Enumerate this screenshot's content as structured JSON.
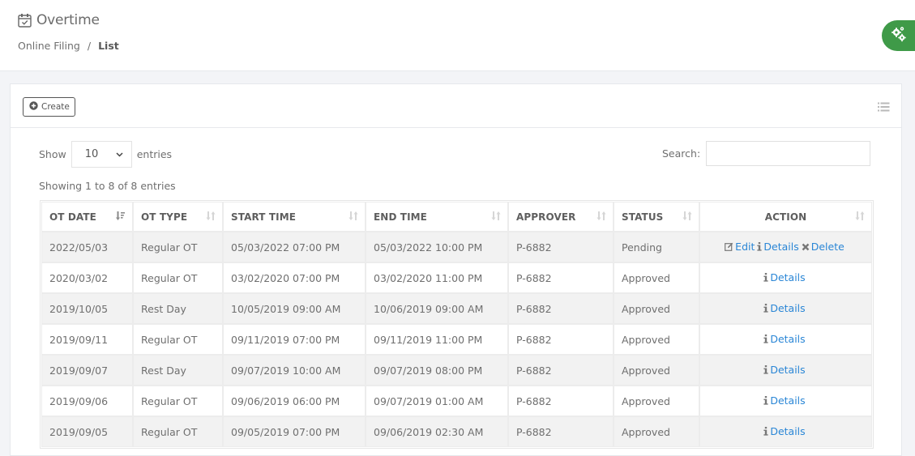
{
  "header": {
    "title": "Overtime",
    "title_icon": "calendar-check-icon",
    "breadcrumb": [
      {
        "label": "Online Filing",
        "active": false
      },
      {
        "label": "List",
        "active": true
      }
    ],
    "breadcrumb_separator": "/"
  },
  "fab": {
    "icon": "gears-icon",
    "color": "#3f9a48"
  },
  "toolbar": {
    "create_label": "Create",
    "create_icon": "plus-circle-icon",
    "list_toggle_icon": "list-icon"
  },
  "datatable": {
    "show_label": "Show",
    "entries_label": "entries",
    "page_length": "10",
    "search_label": "Search:",
    "search_value": "",
    "info": "Showing 1 to 8 of 8 entries",
    "columns": [
      {
        "label": "OT DATE",
        "sort": "desc"
      },
      {
        "label": "OT TYPE",
        "sort": "none"
      },
      {
        "label": "START TIME",
        "sort": "none"
      },
      {
        "label": "END TIME",
        "sort": "none"
      },
      {
        "label": "APPROVER",
        "sort": "none"
      },
      {
        "label": "STATUS",
        "sort": "none"
      },
      {
        "label": "ACTION",
        "sort": "none"
      }
    ],
    "rows": [
      {
        "ot_date": "2022/05/03",
        "ot_type": "Regular OT",
        "start": "05/03/2022 07:00 PM",
        "end": "05/03/2022 10:00 PM",
        "approver": "P-6882",
        "status": "Pending",
        "actions": [
          {
            "label": "Edit",
            "icon": "edit-icon"
          },
          {
            "label": "Details",
            "icon": "info-icon"
          },
          {
            "label": "Delete",
            "icon": "close-icon"
          }
        ]
      },
      {
        "ot_date": "2020/03/02",
        "ot_type": "Regular OT",
        "start": "03/02/2020 07:00 PM",
        "end": "03/02/2020 11:00 PM",
        "approver": "P-6882",
        "status": "Approved",
        "actions": [
          {
            "label": "Details",
            "icon": "info-icon"
          }
        ]
      },
      {
        "ot_date": "2019/10/05",
        "ot_type": "Rest Day",
        "start": "10/05/2019 09:00 AM",
        "end": "10/06/2019 09:00 AM",
        "approver": "P-6882",
        "status": "Approved",
        "actions": [
          {
            "label": "Details",
            "icon": "info-icon"
          }
        ]
      },
      {
        "ot_date": "2019/09/11",
        "ot_type": "Regular OT",
        "start": "09/11/2019 07:00 PM",
        "end": "09/11/2019 11:00 PM",
        "approver": "P-6882",
        "status": "Approved",
        "actions": [
          {
            "label": "Details",
            "icon": "info-icon"
          }
        ]
      },
      {
        "ot_date": "2019/09/07",
        "ot_type": "Rest Day",
        "start": "09/07/2019 10:00 AM",
        "end": "09/07/2019 08:00 PM",
        "approver": "P-6882",
        "status": "Approved",
        "actions": [
          {
            "label": "Details",
            "icon": "info-icon"
          }
        ]
      },
      {
        "ot_date": "2019/09/06",
        "ot_type": "Regular OT",
        "start": "09/06/2019 06:00 PM",
        "end": "09/07/2019 01:00 AM",
        "approver": "P-6882",
        "status": "Approved",
        "actions": [
          {
            "label": "Details",
            "icon": "info-icon"
          }
        ]
      },
      {
        "ot_date": "2019/09/05",
        "ot_type": "Regular OT",
        "start": "09/05/2019 07:00 PM",
        "end": "09/06/2019 02:30 AM",
        "approver": "P-6882",
        "status": "Approved",
        "actions": [
          {
            "label": "Details",
            "icon": "info-icon"
          }
        ]
      }
    ]
  },
  "colors": {
    "link": "#2a86d6",
    "stripe": "#f2f2f2",
    "accent": "#3f9a48"
  }
}
